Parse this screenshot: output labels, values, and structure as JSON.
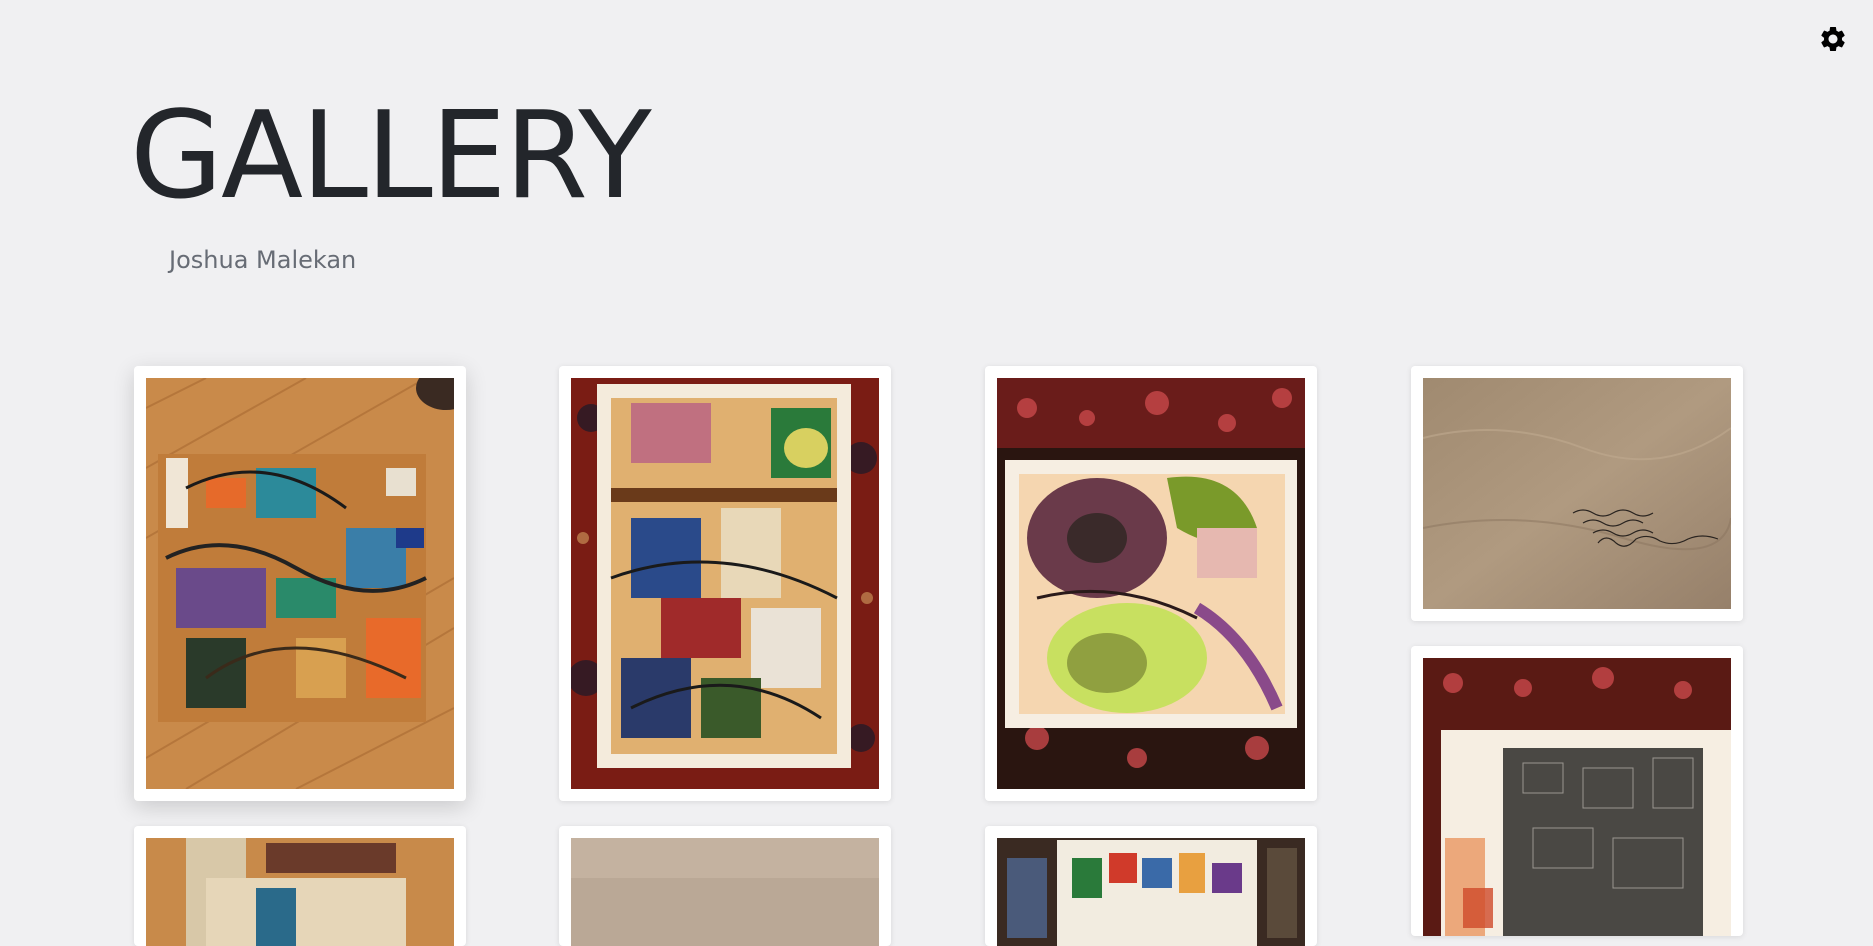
{
  "header": {
    "title": "GALLERY",
    "artist": "Joshua Malekan"
  },
  "toolbar": {
    "settings_icon": "gear-icon"
  },
  "colors": {
    "background": "#f0f0f2",
    "card": "#ffffff",
    "title": "#23262b",
    "subtitle": "#676c75"
  },
  "gallery": {
    "items": [
      {
        "name": "painting-abstract-on-wood-floor"
      },
      {
        "name": "painting-figures-on-rug"
      },
      {
        "name": "painting-face-on-rug"
      },
      {
        "name": "drawing-signed-paper"
      },
      {
        "name": "painting-dark-grid-on-rug"
      },
      {
        "name": "painting-fabric-bottom"
      },
      {
        "name": "painting-beige-bottom"
      },
      {
        "name": "painting-collage-bottom"
      }
    ]
  }
}
